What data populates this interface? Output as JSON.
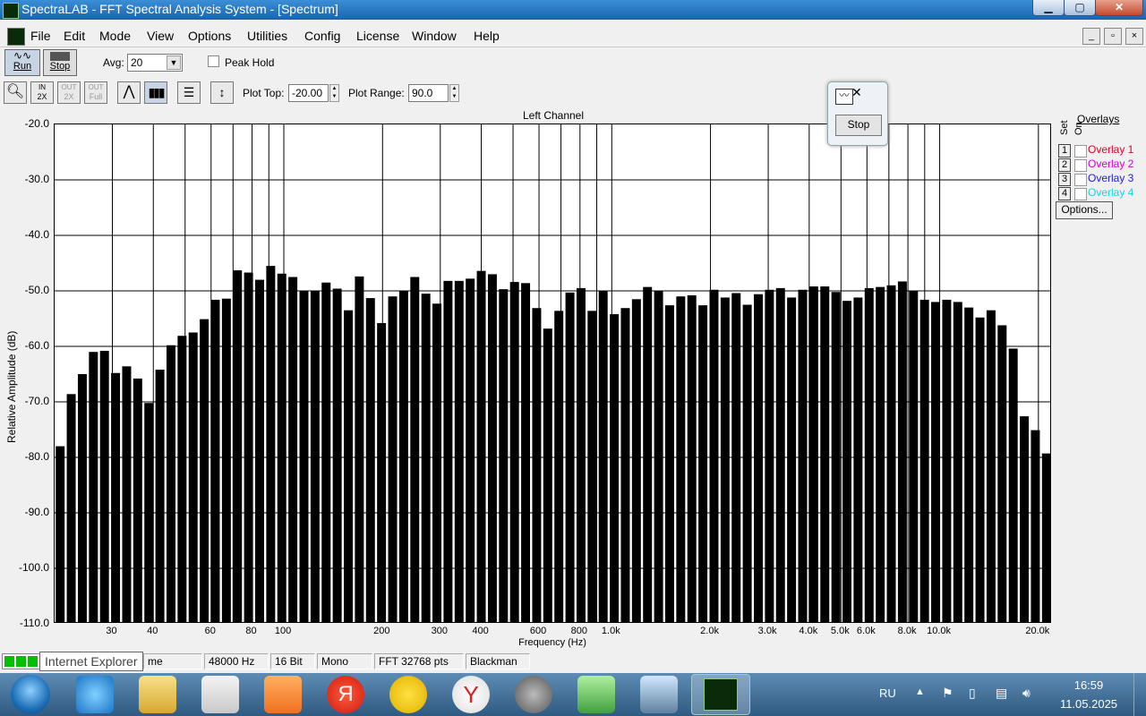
{
  "window": {
    "title": "SpectraLAB - FFT Spectral Analysis System - [Spectrum]",
    "min": "▁",
    "max": "▢",
    "close": "✕"
  },
  "menu": [
    "File",
    "Edit",
    "Mode",
    "View",
    "Options",
    "Utilities",
    "Config",
    "License",
    "Window",
    "Help"
  ],
  "toolbar": {
    "run_label": "Run",
    "stop_label": "Stop",
    "avg_label": "Avg:",
    "avg_value": "20",
    "peak_hold_label": "Peak Hold",
    "zoom_in_label": "2X",
    "zoom_out_label": "2X",
    "zoom_full_label": "Full",
    "plot_top_label": "Plot Top:",
    "plot_top_value": "-20.00",
    "plot_range_label": "Plot Range:",
    "plot_range_value": "90.0"
  },
  "popup": {
    "stop_label": "Stop"
  },
  "overlays": {
    "header": "Overlays",
    "set_label": "Set",
    "on_label": "On",
    "items": [
      {
        "num": "1",
        "label": "Overlay 1",
        "color": "#e0002a"
      },
      {
        "num": "2",
        "label": "Overlay 2",
        "color": "#d000d0"
      },
      {
        "num": "3",
        "label": "Overlay 3",
        "color": "#2020d0"
      },
      {
        "num": "4",
        "label": "Overlay 4",
        "color": "#20d0e0"
      }
    ],
    "options_label": "Options..."
  },
  "chart_data": {
    "type": "bar",
    "title": "Left Channel",
    "xlabel": "Frequency (Hz)",
    "ylabel": "Relative Amplitude (dB)",
    "ylim": [
      -110,
      -20
    ],
    "xlim": [
      20,
      22000
    ],
    "x_scale": "log",
    "grid": true,
    "y_ticks": [
      "-20.0",
      "-30.0",
      "-40.0",
      "-50.0",
      "-60.0",
      "-70.0",
      "-80.0",
      "-90.0",
      "-100.0",
      "-110.0"
    ],
    "x_ticks": [
      {
        "f": 30,
        "label": "30"
      },
      {
        "f": 40,
        "label": "40"
      },
      {
        "f": 60,
        "label": "60"
      },
      {
        "f": 80,
        "label": "80"
      },
      {
        "f": 100,
        "label": "100"
      },
      {
        "f": 200,
        "label": "200"
      },
      {
        "f": 300,
        "label": "300"
      },
      {
        "f": 400,
        "label": "400"
      },
      {
        "f": 600,
        "label": "600"
      },
      {
        "f": 800,
        "label": "800"
      },
      {
        "f": 1000,
        "label": "1.0k"
      },
      {
        "f": 2000,
        "label": "2.0k"
      },
      {
        "f": 3000,
        "label": "3.0k"
      },
      {
        "f": 4000,
        "label": "4.0k"
      },
      {
        "f": 5000,
        "label": "5.0k"
      },
      {
        "f": 6000,
        "label": "6.0k"
      },
      {
        "f": 8000,
        "label": "8.0k"
      },
      {
        "f": 10000,
        "label": "10.0k"
      },
      {
        "f": 20000,
        "label": "20.0k"
      }
    ],
    "grid_freqs": [
      30,
      40,
      50,
      60,
      70,
      80,
      90,
      100,
      200,
      300,
      400,
      500,
      600,
      700,
      800,
      900,
      1000,
      2000,
      3000,
      4000,
      5000,
      6000,
      7000,
      8000,
      9000,
      10000,
      20000
    ],
    "values": [
      -78.0,
      -68.6,
      -65.0,
      -61.0,
      -60.8,
      -64.8,
      -63.6,
      -65.8,
      -70.2,
      -64.2,
      -59.8,
      -58.1,
      -57.5,
      -55.1,
      -51.6,
      -51.4,
      -46.3,
      -46.7,
      -48.0,
      -45.5,
      -46.9,
      -47.5,
      -50.0,
      -50.0,
      -48.5,
      -49.6,
      -53.5,
      -47.4,
      -51.3,
      -55.8,
      -51.0,
      -50.0,
      -47.5,
      -50.5,
      -52.3,
      -48.2,
      -48.2,
      -47.8,
      -46.4,
      -47.0,
      -49.7,
      -48.4,
      -48.6,
      -53.1,
      -56.8,
      -53.6,
      -50.3,
      -49.5,
      -53.6,
      -50.0,
      -54.2,
      -53.1,
      -51.5,
      -49.3,
      -50.0,
      -52.6,
      -51.0,
      -50.8,
      -52.6,
      -49.8,
      -51.2,
      -50.4,
      -52.5,
      -50.6,
      -49.8,
      -49.5,
      -51.2,
      -49.8,
      -49.2,
      -49.2,
      -50.2,
      -51.8,
      -51.2,
      -49.5,
      -49.3,
      -49.0,
      -48.3,
      -50.0,
      -51.6,
      -52.0,
      -51.6,
      -52.0,
      -53.0,
      -54.8,
      -53.5,
      -56.2,
      -60.4,
      -72.6,
      -75.1,
      -79.3
    ]
  },
  "status": {
    "indicator_tooltip": "Internet Explorer",
    "mode": "me",
    "sample_rate": "48000 Hz",
    "bits": "16 Bit",
    "channels": "Mono",
    "fft": "FFT 32768 pts",
    "window": "Blackman"
  },
  "taskbar": {
    "lang": "RU",
    "time": "16:59",
    "date": "11.05.2025"
  }
}
